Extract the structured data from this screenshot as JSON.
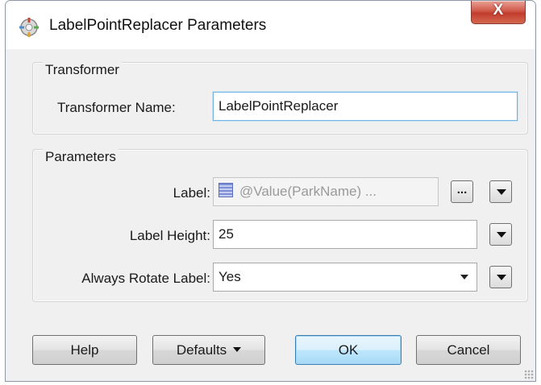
{
  "window": {
    "title": "LabelPointReplacer Parameters",
    "close_label": "X"
  },
  "transformer_group": {
    "label": "Transformer",
    "name_label": "Transformer Name:",
    "name_value": "LabelPointReplacer"
  },
  "parameters_group": {
    "label": "Parameters",
    "label_field": {
      "label": "Label:",
      "value": "@Value(ParkName) ...",
      "ellipsis_button": "..."
    },
    "label_height": {
      "label": "Label Height:",
      "value": "25"
    },
    "always_rotate": {
      "label": "Always Rotate Label:",
      "value": "Yes"
    }
  },
  "buttons": {
    "help": "Help",
    "defaults": "Defaults",
    "ok": "OK",
    "cancel": "Cancel"
  },
  "colors": {
    "dialog_bg": "#f0f0f0",
    "close_button": "#c23c2d",
    "ok_button": "#bee6fd"
  }
}
